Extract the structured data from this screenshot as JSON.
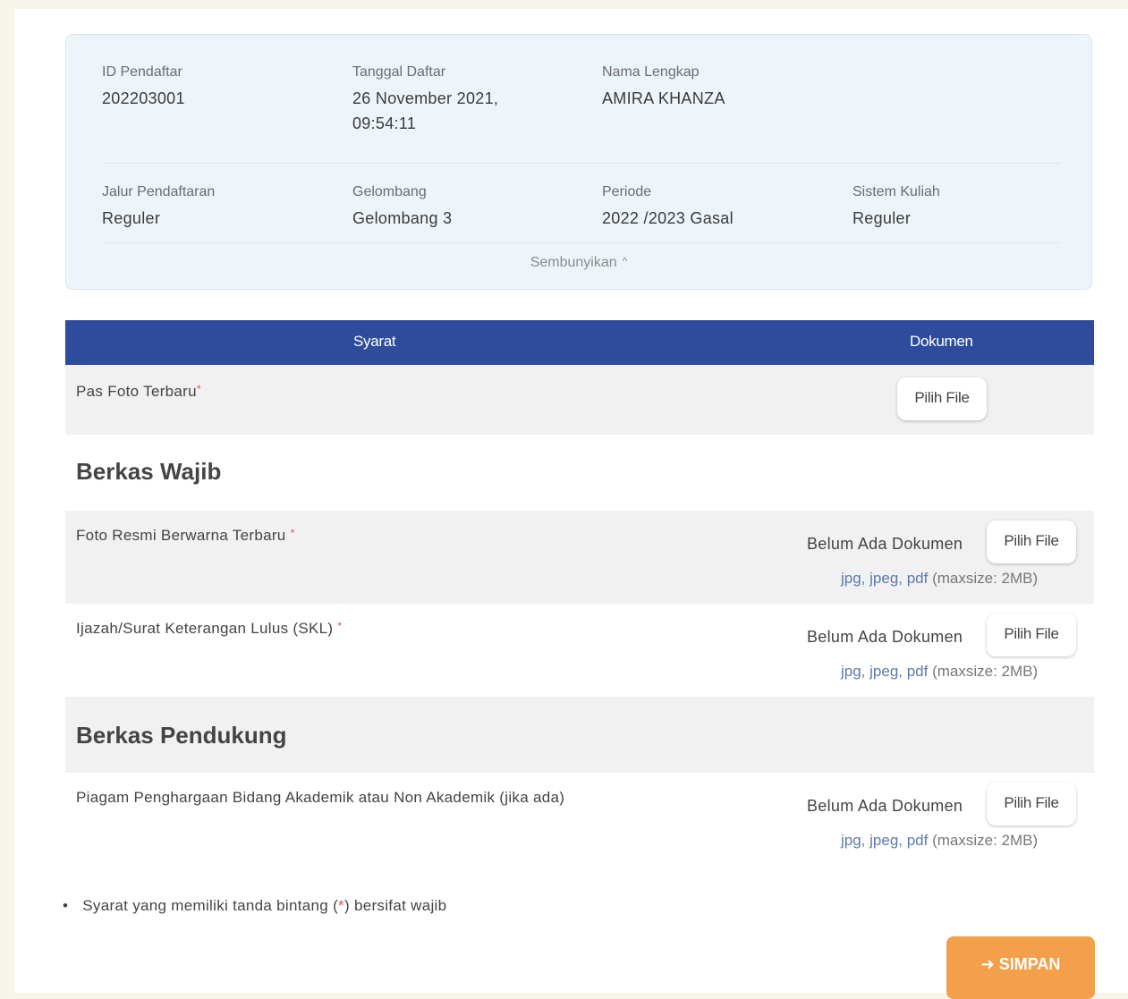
{
  "info": {
    "id_label": "ID Pendaftar",
    "id_value": "202203001",
    "date_label": "Tanggal Daftar",
    "date_value_line1": "26 November 2021,",
    "date_value_line2": "09:54:11",
    "name_label": "Nama Lengkap",
    "name_value": "AMIRA KHANZA",
    "route_label": "Jalur Pendaftaran",
    "route_value": "Reguler",
    "wave_label": "Gelombang",
    "wave_value": "Gelombang 3",
    "period_label": "Periode",
    "period_value": "2022 /2023 Gasal",
    "system_label": "Sistem Kuliah",
    "system_value": "Reguler",
    "toggle_label": "Sembunyikan",
    "toggle_icon": "chevron-up-icon"
  },
  "table": {
    "col_requirement": "Syarat",
    "col_document": "Dokumen"
  },
  "rows": {
    "photo_label": "Pas Foto Terbaru",
    "required_mark": "*",
    "section_mandatory": "Berkas Wajib",
    "official_photo_label": "Foto Resmi Berwarna Terbaru ",
    "diploma_label": "Ijazah/Surat Keterangan Lulus (SKL) ",
    "section_supporting": "Berkas Pendukung",
    "award_label": "Piagam Penghargaan Bidang Akademik atau Non Akademik (jika ada)"
  },
  "upload": {
    "button_label": "Pilih File",
    "no_document": "Belum Ada Dokumen",
    "formats": "jpg, jpeg, pdf",
    "maxsize": "(maxsize: 2MB)"
  },
  "note": {
    "bullet": "•",
    "text_before": "Syarat yang memiliki tanda bintang (",
    "star": "*",
    "text_after": ") bersifat wajib"
  },
  "save": {
    "icon": "arrow-right-icon",
    "label": "SIMPAN"
  },
  "colors": {
    "header_blue": "#2e4c9b",
    "save_orange": "#f4a04a",
    "required_red": "#d9534f"
  }
}
